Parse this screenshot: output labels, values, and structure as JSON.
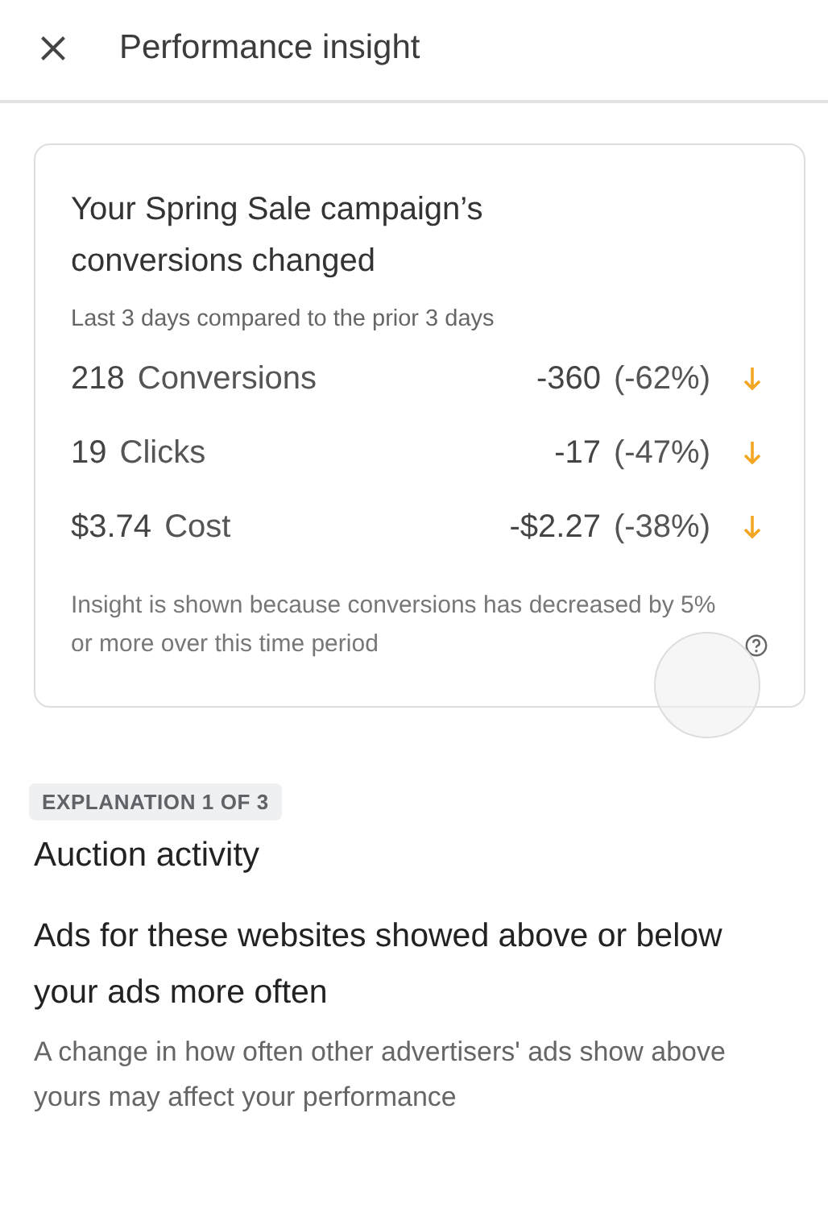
{
  "header": {
    "title": "Performance insight"
  },
  "card": {
    "title": "Your Spring Sale campaign’s conversions changed",
    "subtitle": "Last 3 days compared to the prior 3 days",
    "metrics": [
      {
        "value": "218",
        "name": "Conversions",
        "change": "-360",
        "percent": "(-62%)",
        "decreased": true
      },
      {
        "value": "19",
        "name": "Clicks",
        "change": "-17",
        "percent": "(-47%)",
        "decreased": true
      },
      {
        "value": "$3.74",
        "name": "Cost",
        "change": "-$2.27",
        "percent": "(-38%)",
        "decreased": true
      }
    ],
    "note": "Insight is shown because conversions has decreased by 5% or more over this time period"
  },
  "explanation": {
    "badge": "EXPLANATION 1 OF 3",
    "category": "Auction activity",
    "heading": "Ads for these websites showed above or below your ads more often",
    "body": "A change in how often other advertisers' ads show above yours may affect your performance"
  }
}
